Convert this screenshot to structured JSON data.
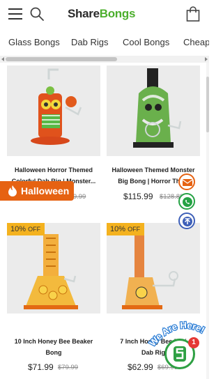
{
  "header": {
    "brand_part1": "Share",
    "brand_part2": "Bongs"
  },
  "categories": [
    "Glass Bongs",
    "Dab Rigs",
    "Cool Bongs",
    "Cheap"
  ],
  "products": [
    {
      "title_line1": "Halloween Horror Themed",
      "title_line2": "Colorful Dab Rig | Monster...",
      "price": "",
      "old_price": "$179.99"
    },
    {
      "title_line1": "Halloween Themed Monster",
      "title_line2": "Big Bong | Horror The...",
      "price": "$115.99",
      "old_price": "$128.89"
    },
    {
      "badge": "10%",
      "badge_off": "OFF",
      "title_line1": "10 Inch Honey Bee Beaker",
      "title_line2": "Bong",
      "price": "$71.99",
      "old_price": "$79.99"
    },
    {
      "badge": "10%",
      "badge_off": "OFF",
      "title_line1": "7 Inch Honey Bee Mini",
      "title_line2": "Dab Rig",
      "price": "$62.99",
      "old_price": "$69.99"
    }
  ],
  "promo": {
    "label": "Halloween"
  },
  "chat": {
    "text": "We Are Here!",
    "badge_count": "1"
  },
  "colors": {
    "brand_green": "#4caf2d",
    "promo_orange": "#e66212",
    "badge_yellow": "#f4b21f"
  }
}
